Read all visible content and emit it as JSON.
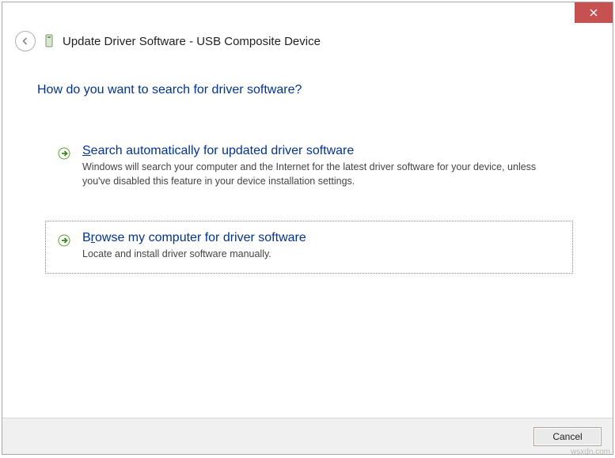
{
  "titlebar": {
    "close_tooltip": "Close"
  },
  "header": {
    "title": "Update Driver Software - USB Composite Device"
  },
  "content": {
    "question": "How do you want to search for driver software?",
    "options": [
      {
        "title_pre": "S",
        "title_rest": "earch automatically for updated driver software",
        "desc": "Windows will search your computer and the Internet for the latest driver software for your device, unless you've disabled this feature in your device installation settings."
      },
      {
        "title_pre": "B",
        "title_mid": "r",
        "title_rest": "owse my computer for driver software",
        "desc": "Locate and install driver software manually."
      }
    ]
  },
  "footer": {
    "cancel_label": "Cancel"
  },
  "watermark": "wsxdn.com"
}
